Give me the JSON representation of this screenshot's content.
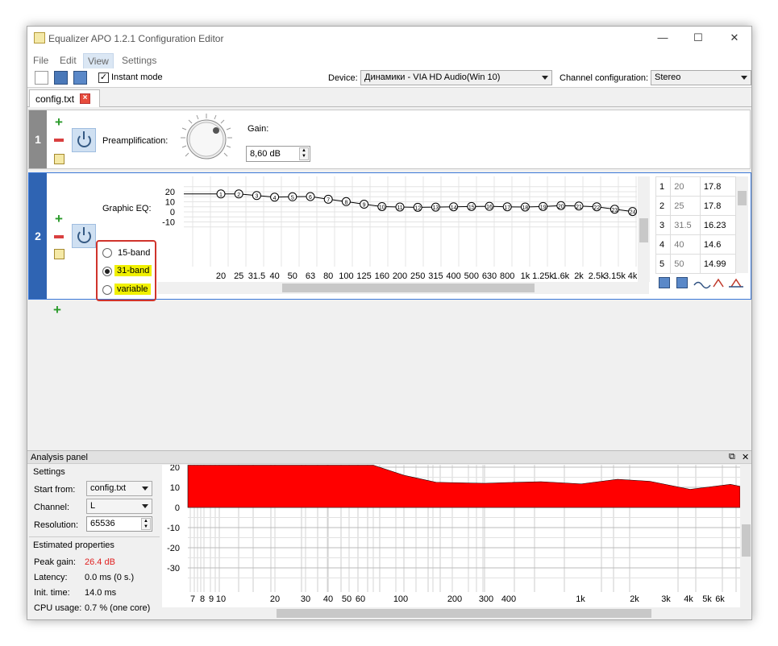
{
  "window": {
    "title": "Equalizer APO 1.2.1 Configuration Editor"
  },
  "menu": [
    "File",
    "Edit",
    "View",
    "Settings"
  ],
  "toolbar": {
    "instant_mode_label": "Instant mode",
    "instant_mode_checked": true,
    "device_label": "Device:",
    "device_value": "Динамики - VIA HD Audio(Win 10)",
    "channel_config_label": "Channel configuration:",
    "channel_config_value": "Stereo"
  },
  "tabs": [
    {
      "label": "config.txt"
    }
  ],
  "filter1": {
    "number": "1",
    "preamp_label": "Preamplification:",
    "gain_label": "Gain:",
    "gain_value": "8,60 dB"
  },
  "filter2": {
    "number": "2",
    "label": "Graphic EQ:",
    "band_options": [
      "15-band",
      "31-band",
      "variable"
    ],
    "selected_option": "31-band",
    "graph": {
      "y_ticks": [
        "20",
        "10",
        "0",
        "-10"
      ],
      "x_ticks": [
        "20",
        "25",
        "31.5",
        "40",
        "50",
        "63",
        "80",
        "100",
        "125",
        "160",
        "200",
        "250",
        "315",
        "400",
        "500",
        "630",
        "800",
        "1k",
        "1.25k",
        "1.6k",
        "2k",
        "2.5k",
        "3.15k",
        "4k"
      ],
      "nodes": [
        {
          "n": "1",
          "db": 17.8
        },
        {
          "n": "2",
          "db": 17.8
        },
        {
          "n": "3",
          "db": 16.23
        },
        {
          "n": "4",
          "db": 14.6
        },
        {
          "n": "5",
          "db": 14.99
        },
        {
          "n": "6",
          "db": 15.2
        },
        {
          "n": "7",
          "db": 12.5
        },
        {
          "n": "8",
          "db": 10.2
        },
        {
          "n": "9",
          "db": 7.6
        },
        {
          "n": "10",
          "db": 5.2
        },
        {
          "n": "11",
          "db": 4.8
        },
        {
          "n": "12",
          "db": 4.5
        },
        {
          "n": "13",
          "db": 4.7
        },
        {
          "n": "14",
          "db": 5.0
        },
        {
          "n": "15",
          "db": 5.3
        },
        {
          "n": "16",
          "db": 5.5
        },
        {
          "n": "17",
          "db": 5.0
        },
        {
          "n": "18",
          "db": 4.8
        },
        {
          "n": "19",
          "db": 5.3
        },
        {
          "n": "20",
          "db": 6.2
        },
        {
          "n": "21",
          "db": 5.8
        },
        {
          "n": "22",
          "db": 5.0
        },
        {
          "n": "23",
          "db": 2.6
        },
        {
          "n": "24",
          "db": 0.3
        }
      ]
    },
    "table": [
      {
        "idx": "1",
        "freq": "20",
        "gain": "17.8"
      },
      {
        "idx": "2",
        "freq": "25",
        "gain": "17.8"
      },
      {
        "idx": "3",
        "freq": "31.5",
        "gain": "16.23"
      },
      {
        "idx": "4",
        "freq": "40",
        "gain": "14.6"
      },
      {
        "idx": "5",
        "freq": "50",
        "gain": "14.99"
      }
    ]
  },
  "analysis": {
    "title": "Analysis panel",
    "settings_title": "Settings",
    "start_from_label": "Start from:",
    "start_from_value": "config.txt",
    "channel_label": "Channel:",
    "channel_value": "L",
    "resolution_label": "Resolution:",
    "resolution_value": "65536",
    "estimated_title": "Estimated properties",
    "peak_gain_label": "Peak gain:",
    "peak_gain_value": "26.4 dB",
    "latency_label": "Latency:",
    "latency_value": "0.0 ms (0 s.)",
    "init_time_label": "Init. time:",
    "init_time_value": "14.0 ms",
    "cpu_label": "CPU usage:",
    "cpu_value": "0.7 % (one core)",
    "y_ticks": [
      "20",
      "10",
      "0",
      "-10",
      "-20",
      "-30"
    ],
    "x_ticks": [
      "7",
      "8",
      "9",
      "10",
      "20",
      "30",
      "40",
      "50",
      "60",
      "100",
      "200",
      "300",
      "400",
      "1k",
      "2k",
      "3k",
      "4k",
      "5k",
      "6k"
    ],
    "fill_color": "#ff0000"
  }
}
